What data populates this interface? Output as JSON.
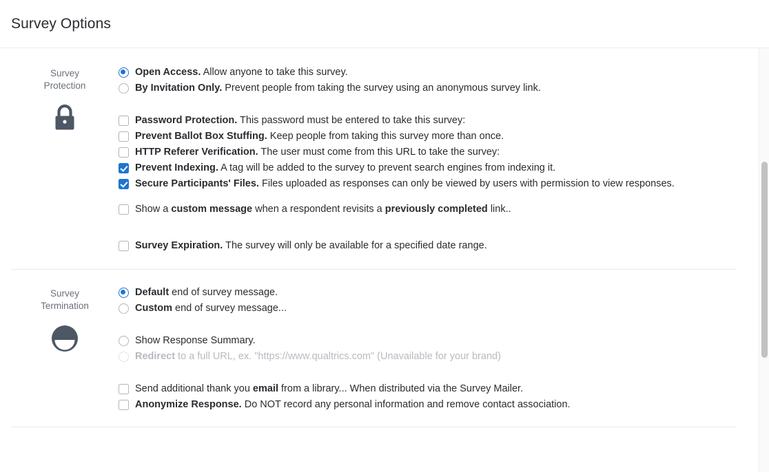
{
  "header": {
    "title": "Survey Options"
  },
  "sections": [
    {
      "label": "Survey\nProtection",
      "icon": "lock-icon",
      "radios": [
        {
          "checked": true,
          "strong": "Open Access.",
          "rest": " Allow anyone to take this survey."
        },
        {
          "checked": false,
          "strong": "By Invitation Only.",
          "rest": " Prevent people from taking the survey using an anonymous survey link."
        }
      ],
      "checkboxes": [
        {
          "checked": false,
          "strong": "Password Protection.",
          "rest": " This password must be entered to take this survey:"
        },
        {
          "checked": false,
          "strong": "Prevent Ballot Box Stuffing.",
          "rest": " Keep people from taking this survey more than once."
        },
        {
          "checked": false,
          "strong": "HTTP Referer Verification.",
          "rest": " The user must come from this URL to take the survey:"
        },
        {
          "checked": true,
          "strong": "Prevent Indexing.",
          "rest": " A tag will be added to the survey to prevent search engines from indexing it."
        },
        {
          "checked": true,
          "strong": "Secure Participants' Files.",
          "rest": " Files uploaded as responses can only be viewed by users with permission to view responses."
        }
      ],
      "custom_message": {
        "checked": false,
        "pre": "Show a ",
        "strong1": "custom message",
        "mid": " when a respondent revisits a ",
        "strong2": "previously completed",
        "post": " link.."
      },
      "expiration": {
        "checked": false,
        "strong": "Survey Expiration.",
        "rest": " The survey will only be available for a specified date range."
      }
    },
    {
      "label": "Survey\nTermination",
      "icon": "stop-circle-icon",
      "radios_message": [
        {
          "checked": true,
          "strong": "Default",
          "rest": " end of survey message."
        },
        {
          "checked": false,
          "strong": "Custom",
          "rest": " end of survey message..."
        }
      ],
      "radios_action": [
        {
          "checked": false,
          "disabled": false,
          "strong": "",
          "rest": "Show Response Summary."
        },
        {
          "checked": false,
          "disabled": true,
          "strong": "Redirect",
          "rest": " to a full URL, ex. \"https://www.qualtrics.com\" (Unavailable for your brand)"
        }
      ],
      "checkboxes": [
        {
          "checked": false,
          "pre": "Send additional thank you ",
          "strong1": "email",
          "post": " from a library... When distributed via the Survey Mailer."
        },
        {
          "checked": false,
          "strong": "Anonymize Response.",
          "rest": " Do NOT record any personal information and remove contact association."
        }
      ]
    }
  ],
  "colors": {
    "accent": "#1f73d2",
    "text": "#2b2c31",
    "muted": "#6b707a",
    "disabled": "#b7bac0",
    "icon": "#4e5764",
    "divider": "#e7e8ea",
    "scrollbar_thumb": "#c2c2c4"
  },
  "scrollbar": {
    "name": "vertical-scrollbar"
  }
}
